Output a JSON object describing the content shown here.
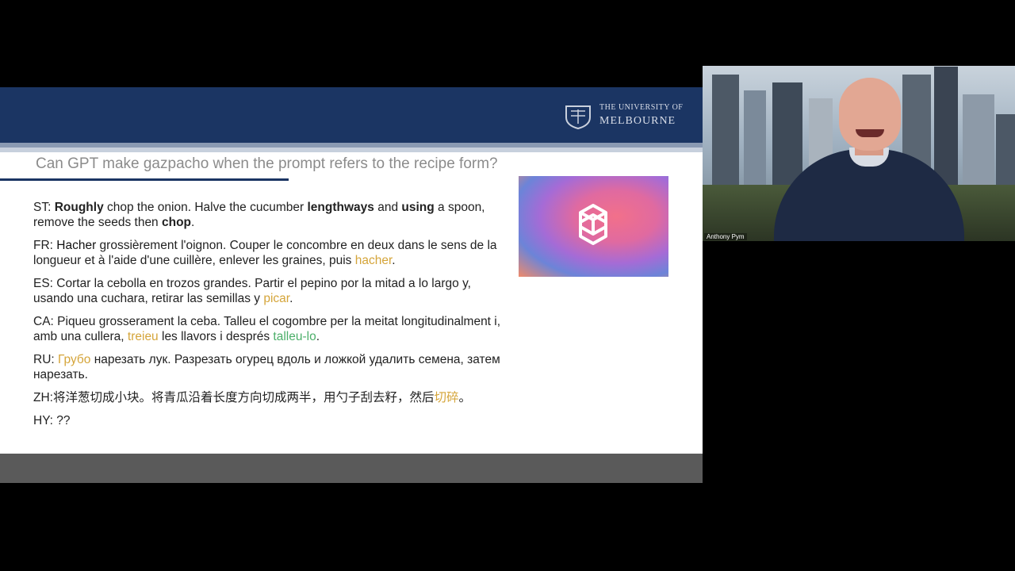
{
  "slide": {
    "logo": {
      "line1": "THE UNIVERSITY OF",
      "line2": "MELBOURNE"
    },
    "title": "Can GPT make gazpacho when the prompt refers to the recipe form?",
    "paragraphs": {
      "st": {
        "label": "ST: ",
        "w1": "Roughly",
        "t1": " chop the onion. Halve the cucumber ",
        "w2": "lengthways",
        "t2": " and ",
        "w3": "using",
        "t3": " a spoon, remove the seeds then ",
        "w4": "chop",
        "t4": "."
      },
      "fr": {
        "label": "FR: ",
        "w1": "Hacher",
        "t1": " grossièrement l'oignon. Couper le concombre en deux dans le sens de la longueur et à l'aide d'une cuillère, enlever les graines, puis ",
        "w2": "hacher",
        "t2": "."
      },
      "es": {
        "label": "ES: ",
        "t1": "Cortar la cebolla en trozos grandes. Partir el pepino por la mitad a lo largo y, usando una cuchara, retirar las semillas y ",
        "w1": "picar",
        "t2": "."
      },
      "ca": {
        "label": "CA: ",
        "t1": "Piqueu grosserament la ceba. Talleu el cogombre per la meitat longitudinalment i, amb una cullera, ",
        "w1": "treieu",
        "t2": " les llavors i després ",
        "w2": "talleu-lo",
        "t3": "."
      },
      "ru": {
        "label": "RU: ",
        "w1": "Грубо",
        "t1": " нарезать лук. Разрезать огурец вдоль и ложкой удалить семена, затем нарезать."
      },
      "zh": {
        "label": "ZH:",
        "t1": "将洋葱切成小块。将青瓜沿着长度方向切成两半，用勺子刮去籽，然后",
        "w1": "切碎",
        "t2": "。"
      },
      "hy": {
        "label": "HY: ",
        "t1": "??"
      }
    }
  },
  "webcam": {
    "participant_name": "Anthony Pym"
  },
  "colors": {
    "header": "#1b3563",
    "highlight_gold": "#d5a53a",
    "highlight_green": "#4caf6a"
  },
  "icons": {
    "logo": "university-crest-icon",
    "openai": "openai-logo-icon"
  }
}
